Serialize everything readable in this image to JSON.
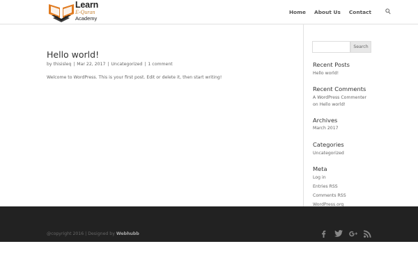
{
  "header": {
    "logo": {
      "line1": "Learn",
      "line2": "E-Quran",
      "line3": "Academy"
    },
    "nav": [
      {
        "label": "Home"
      },
      {
        "label": "About Us"
      },
      {
        "label": "Contact"
      }
    ],
    "search_icon": "search-icon"
  },
  "post": {
    "title": "Hello world!",
    "meta": {
      "author": "thisisleq",
      "date": "Mar 22, 2017",
      "category": "Uncategorized",
      "comments": "1 comment",
      "separator": "|",
      "prefix": "by"
    },
    "body": "Welcome to WordPress. This is your first post. Edit or delete it, then start writing!"
  },
  "sidebar": {
    "search": {
      "placeholder": "",
      "button_label": "Search"
    },
    "recent_posts": {
      "title": "Recent Posts",
      "items": [
        "Hello world!"
      ]
    },
    "recent_comments": {
      "title": "Recent Comments",
      "author": "A WordPress Commenter",
      "on_text": "on",
      "post": "Hello world!"
    },
    "archives": {
      "title": "Archives",
      "items": [
        "March 2017"
      ]
    },
    "categories": {
      "title": "Categories",
      "items": [
        "Uncategorized"
      ]
    },
    "meta": {
      "title": "Meta",
      "items": [
        "Log in",
        "Entries RSS",
        "Comments RSS",
        "WordPress.org"
      ]
    }
  },
  "footer": {
    "copyright": "@copyright 2016 | Designed by",
    "designer": "Webhubb",
    "social": [
      "facebook-icon",
      "twitter-icon",
      "google-plus-icon",
      "rss-icon"
    ]
  },
  "colors": {
    "logo_accent": "#c9873a",
    "footer_bg": "#222222",
    "text": "#666666",
    "heading": "#333333"
  }
}
